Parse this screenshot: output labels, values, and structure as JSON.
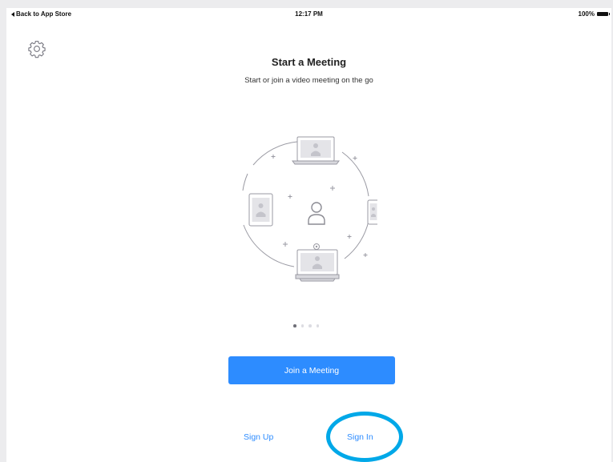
{
  "status_bar": {
    "back_label": "Back to App Store",
    "time": "12:17 PM",
    "battery": "100%"
  },
  "header": {
    "settings_icon": "gear-icon"
  },
  "main": {
    "title": "Start a Meeting",
    "subtitle": "Start or join a video meeting on the go",
    "illustration_icon": "devices-circle-illustration",
    "page_indicator": {
      "count": 4,
      "active_index": 0
    }
  },
  "actions": {
    "join_label": "Join a Meeting",
    "sign_up_label": "Sign Up",
    "sign_in_label": "Sign In"
  },
  "colors": {
    "accent": "#2d8cff",
    "highlight": "#00a8e8",
    "illustration_stroke": "#9a9aa3"
  }
}
